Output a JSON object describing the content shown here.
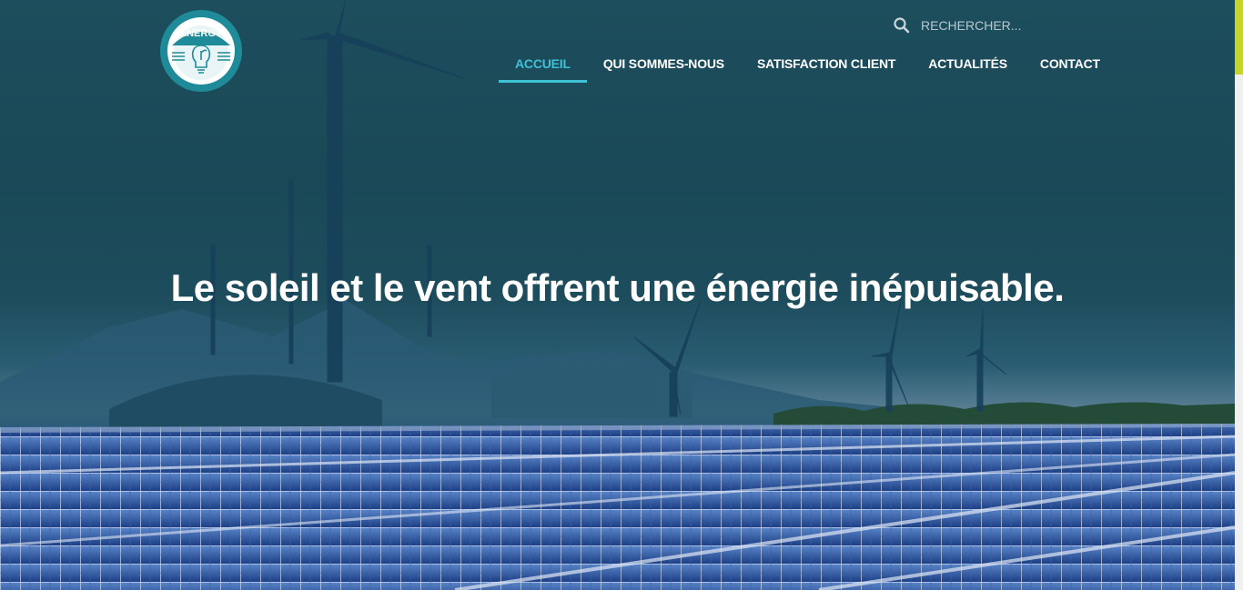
{
  "logo": {
    "text": "ENERGY"
  },
  "search": {
    "placeholder": "RECHERCHER..."
  },
  "nav": {
    "items": [
      {
        "label": "ACCUEIL",
        "active": true
      },
      {
        "label": "QUI SOMMES-NOUS",
        "active": false
      },
      {
        "label": "SATISFACTION CLIENT",
        "active": false
      },
      {
        "label": "ACTUALITÉS",
        "active": false
      },
      {
        "label": "CONTACT",
        "active": false
      }
    ]
  },
  "hero": {
    "headline": "Le soleil et le vent offrent une énergie inépuisable."
  },
  "colors": {
    "accent": "#3fc1d6",
    "overlay": "#1a4857",
    "scroll_thumb": "#c6d32a"
  }
}
